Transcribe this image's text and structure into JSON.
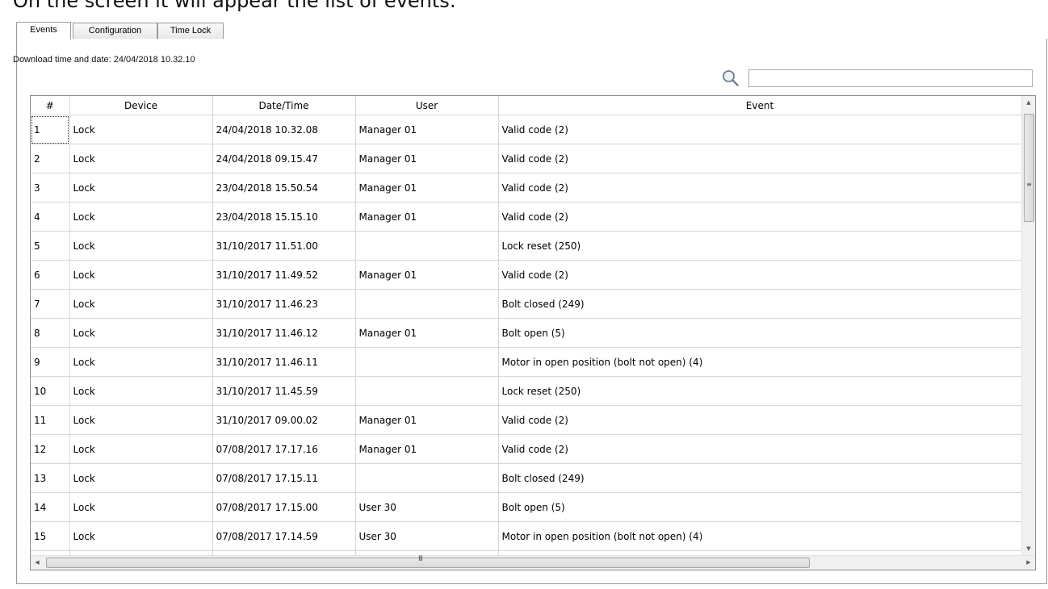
{
  "page": {
    "heading": "On the screen it will appear the list of events:"
  },
  "tabs": [
    {
      "label": "Events",
      "active": true
    },
    {
      "label": "Configuration",
      "active": false
    },
    {
      "label": "Time Lock",
      "active": false
    }
  ],
  "download": {
    "text": "Download time and date: 24/04/2018 10.32.10"
  },
  "search": {
    "icon": "magnifier-icon",
    "value": ""
  },
  "table": {
    "columns": [
      "#",
      "Device",
      "Date/Time",
      "User",
      "Event"
    ],
    "rows": [
      {
        "n": "1",
        "device": "Lock",
        "datetime": "24/04/2018 10.32.08",
        "user": "Manager 01",
        "event": "Valid code (2)"
      },
      {
        "n": "2",
        "device": "Lock",
        "datetime": "24/04/2018 09.15.47",
        "user": "Manager 01",
        "event": "Valid code (2)"
      },
      {
        "n": "3",
        "device": "Lock",
        "datetime": "23/04/2018 15.50.54",
        "user": "Manager 01",
        "event": "Valid code (2)"
      },
      {
        "n": "4",
        "device": "Lock",
        "datetime": "23/04/2018 15.15.10",
        "user": "Manager 01",
        "event": "Valid code (2)"
      },
      {
        "n": "5",
        "device": "Lock",
        "datetime": "31/10/2017 11.51.00",
        "user": "",
        "event": "Lock reset (250)"
      },
      {
        "n": "6",
        "device": "Lock",
        "datetime": "31/10/2017 11.49.52",
        "user": "Manager 01",
        "event": "Valid code (2)"
      },
      {
        "n": "7",
        "device": "Lock",
        "datetime": "31/10/2017 11.46.23",
        "user": "",
        "event": "Bolt closed (249)"
      },
      {
        "n": "8",
        "device": "Lock",
        "datetime": "31/10/2017 11.46.12",
        "user": "Manager 01",
        "event": "Bolt open (5)"
      },
      {
        "n": "9",
        "device": "Lock",
        "datetime": "31/10/2017 11.46.11",
        "user": "",
        "event": "Motor in open position (bolt not open) (4)"
      },
      {
        "n": "10",
        "device": "Lock",
        "datetime": "31/10/2017 11.45.59",
        "user": "",
        "event": "Lock reset (250)"
      },
      {
        "n": "11",
        "device": "Lock",
        "datetime": "31/10/2017 09.00.02",
        "user": "Manager 01",
        "event": "Valid code (2)"
      },
      {
        "n": "12",
        "device": "Lock",
        "datetime": "07/08/2017 17.17.16",
        "user": "Manager 01",
        "event": "Valid code (2)"
      },
      {
        "n": "13",
        "device": "Lock",
        "datetime": "07/08/2017 17.15.11",
        "user": "",
        "event": "Bolt closed (249)"
      },
      {
        "n": "14",
        "device": "Lock",
        "datetime": "07/08/2017 17.15.00",
        "user": "User 30",
        "event": "Bolt open (5)"
      },
      {
        "n": "15",
        "device": "Lock",
        "datetime": "07/08/2017 17.14.59",
        "user": "User 30",
        "event": "Motor in open position (bolt not open) (4)"
      },
      {
        "n": "",
        "device": "",
        "datetime": "",
        "user": "",
        "event": ""
      }
    ]
  },
  "scrollbars": {
    "up_icon": "arrow-up-icon",
    "down_icon": "arrow-down-icon",
    "left_icon": "arrow-left-icon",
    "right_icon": "arrow-right-icon",
    "vgrip": "≡",
    "hgrip": "III"
  },
  "colors": {
    "grid_line": "#d6d6d6",
    "border": "#9a9a9a"
  }
}
